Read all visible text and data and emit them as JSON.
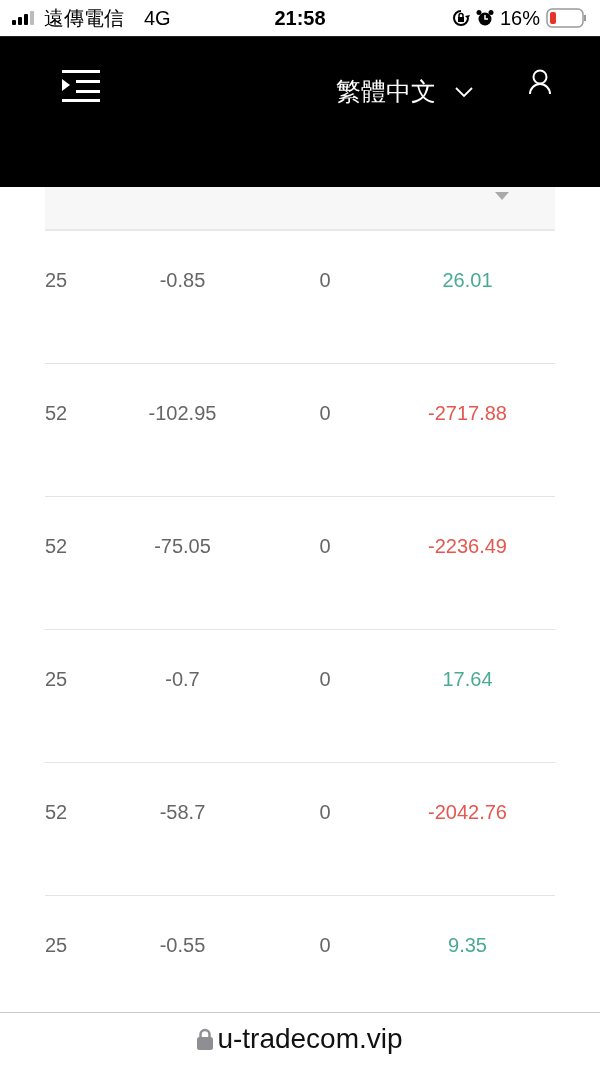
{
  "status_bar": {
    "carrier": "遠傳電信",
    "network": "4G",
    "time": "21:58",
    "battery": "16%"
  },
  "header": {
    "language": "繁體中文"
  },
  "table": {
    "sort_descending": true,
    "rows": [
      {
        "column_1": "25",
        "fee": "-0.85",
        "column_3": "0",
        "profit": "26.01",
        "positive": true
      },
      {
        "column_1": "52",
        "fee": "-102.95",
        "column_3": "0",
        "profit": "-2717.88",
        "positive": false
      },
      {
        "column_1": "52",
        "fee": "-75.05",
        "column_3": "0",
        "profit": "-2236.49",
        "positive": false
      },
      {
        "column_1": "25",
        "fee": "-0.7",
        "column_3": "0",
        "profit": "17.64",
        "positive": true
      },
      {
        "column_1": "52",
        "fee": "-58.7",
        "column_3": "0",
        "profit": "-2042.76",
        "positive": false
      },
      {
        "column_1": "25",
        "fee": "-0.55",
        "column_3": "0",
        "profit": "9.35",
        "positive": true
      }
    ]
  },
  "url_bar": {
    "address": "u-tradecom.vip"
  }
}
